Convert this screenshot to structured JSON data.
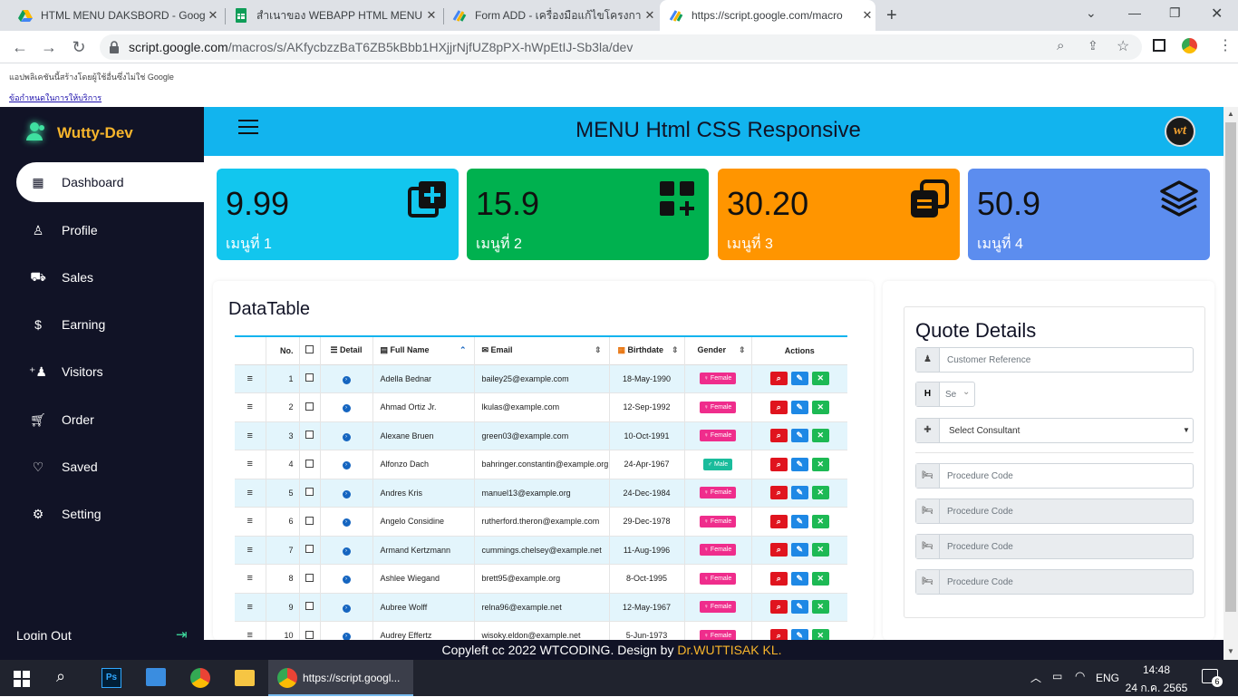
{
  "browser": {
    "tabs": [
      {
        "title": "HTML MENU DAKSBORD - Goog",
        "icon": "google-drive-icon"
      },
      {
        "title": "สำเนาของ WEBAPP HTML MENU E",
        "icon": "google-sheets-icon"
      },
      {
        "title": "Form ADD - เครื่องมือแก้ไขโครงการ",
        "icon": "apps-script-icon"
      },
      {
        "title": "https://script.google.com/macro",
        "icon": "apps-script-icon"
      }
    ],
    "url_host": "script.google.com",
    "url_path": "/macros/s/AKfycbzzBaT6ZB5kBbb1HXjjrNjfUZ8pPX-hWpEtIJ-Sb3la/dev"
  },
  "notice": {
    "text": "แอปพลิเคชันนี้สร้างโดยผู้ใช้อื่นซึ่งไม่ใช่ Google",
    "link": "ข้อกำหนดในการให้บริการ"
  },
  "sidebar": {
    "brand": "Wutty-Dev",
    "items": [
      {
        "label": "Dashboard",
        "icon": "grid-icon"
      },
      {
        "label": "Profile",
        "icon": "user-icon"
      },
      {
        "label": "Sales",
        "icon": "truck-icon"
      },
      {
        "label": "Earning",
        "icon": "dollar-icon"
      },
      {
        "label": "Visitors",
        "icon": "user-plus-icon"
      },
      {
        "label": "Order",
        "icon": "cart-icon"
      },
      {
        "label": "Saved",
        "icon": "heart-icon"
      },
      {
        "label": "Setting",
        "icon": "gear-icon"
      }
    ],
    "logout": "Login Out"
  },
  "header": {
    "title": "MENU Html CSS Responsive",
    "avatar_text": "wt"
  },
  "cards": [
    {
      "value": "9.99",
      "label": "เมนูที่ 1",
      "color": "#12c6ee"
    },
    {
      "value": "15.9",
      "label": "เมนูที่ 2",
      "color": "#00b14f"
    },
    {
      "value": "30.20",
      "label": "เมนูที่ 3",
      "color": "#ff9500"
    },
    {
      "value": "50.9",
      "label": "เมนูที่ 4",
      "color": "#5c8def"
    }
  ],
  "datatable": {
    "title": "DataTable",
    "headers": [
      "No.",
      "Detail",
      "Full Name",
      "Email",
      "Birthdate",
      "Gender",
      "Actions"
    ],
    "rows": [
      {
        "no": "1",
        "name": "Adella Bednar",
        "email": "bailey25@example.com",
        "birth": "18-May-1990",
        "gender": "Female"
      },
      {
        "no": "2",
        "name": "Ahmad Ortiz Jr.",
        "email": "lkulas@example.com",
        "birth": "12-Sep-1992",
        "gender": "Female"
      },
      {
        "no": "3",
        "name": "Alexane Bruen",
        "email": "green03@example.com",
        "birth": "10-Oct-1991",
        "gender": "Female"
      },
      {
        "no": "4",
        "name": "Alfonzo Dach",
        "email": "bahringer.constantin@example.org",
        "birth": "24-Apr-1967",
        "gender": "Male"
      },
      {
        "no": "5",
        "name": "Andres Kris",
        "email": "manuel13@example.org",
        "birth": "24-Dec-1984",
        "gender": "Female"
      },
      {
        "no": "6",
        "name": "Angelo Considine",
        "email": "rutherford.theron@example.com",
        "birth": "29-Dec-1978",
        "gender": "Female"
      },
      {
        "no": "7",
        "name": "Armand Kertzmann",
        "email": "cummings.chelsey@example.net",
        "birth": "11-Aug-1996",
        "gender": "Female"
      },
      {
        "no": "8",
        "name": "Ashlee Wiegand",
        "email": "brett95@example.org",
        "birth": "8-Oct-1995",
        "gender": "Female"
      },
      {
        "no": "9",
        "name": "Aubree Wolff",
        "email": "relna96@example.net",
        "birth": "12-May-1967",
        "gender": "Female"
      },
      {
        "no": "10",
        "name": "Audrey Effertz",
        "email": "wisoky.eldon@example.net",
        "birth": "5-Jun-1973",
        "gender": "Female"
      }
    ]
  },
  "quote": {
    "title": "Quote Details",
    "customer_ref": "Customer Reference",
    "select_short": "Se",
    "consultant": "Select Consultant",
    "procedure": [
      "Procedure Code",
      "Procedure Code",
      "Procedure Code",
      "Procedure Code"
    ]
  },
  "footer": {
    "text": "Copyleft cc 2022 WTCODING. Design by ",
    "author": "Dr.WUTTISAK KL."
  },
  "taskbar": {
    "active_app": "https://script.googl...",
    "lang": "ENG",
    "time": "14:48",
    "date": "24 ก.ค. 2565",
    "notifications": "6"
  }
}
